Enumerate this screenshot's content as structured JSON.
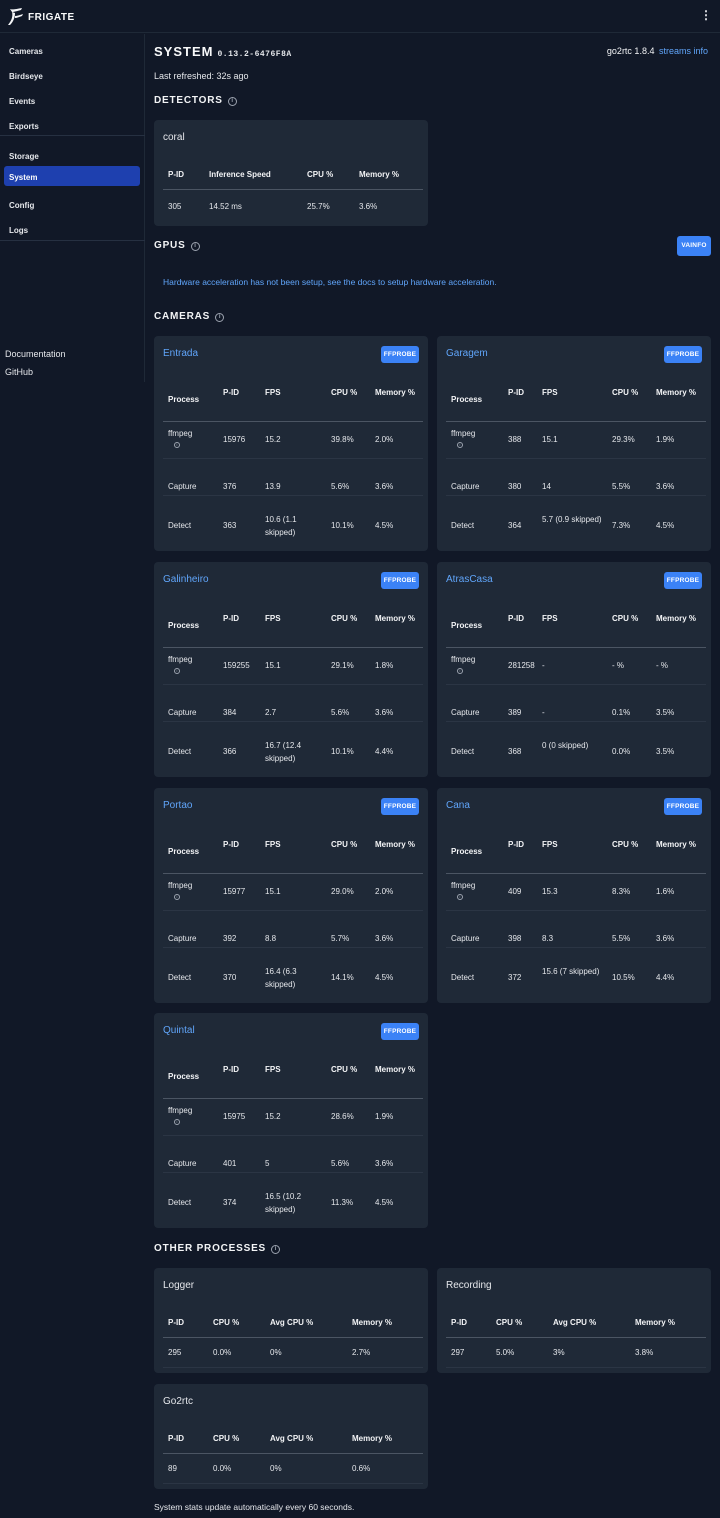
{
  "app": {
    "brand": "FRIGATE",
    "menu_icon": "kebab-menu-icon"
  },
  "sidebar": {
    "items": [
      {
        "label": "Cameras"
      },
      {
        "label": "Birdseye"
      },
      {
        "label": "Events"
      },
      {
        "label": "Exports"
      },
      {
        "label": "Storage"
      },
      {
        "label": "System",
        "active": true
      },
      {
        "label": "Config"
      },
      {
        "label": "Logs"
      }
    ],
    "links": [
      {
        "label": "Documentation"
      },
      {
        "label": "GitHub"
      }
    ]
  },
  "page": {
    "title": "SYSTEM",
    "version": "0.13.2-6476F8A",
    "go2rtc_version": "go2rtc 1.8.4",
    "streams_info": "streams info",
    "last_refreshed": "Last refreshed: 32s ago",
    "footer": "System stats update automatically every 60 seconds."
  },
  "detectors": {
    "section_title": "DETECTORS",
    "items": [
      {
        "name": "coral",
        "headers": [
          "P-ID",
          "Inference Speed",
          "CPU %",
          "Memory %"
        ],
        "row": [
          "305",
          "14.52 ms",
          "25.7%",
          "3.6%"
        ]
      }
    ]
  },
  "gpus": {
    "section_title": "GPUS",
    "vainfo_label": "VAINFO",
    "message": "Hardware acceleration has not been setup, see the docs to setup hardware acceleration."
  },
  "cameras": {
    "section_title": "CAMERAS",
    "ffprobe_label": "FFPROBE",
    "headers": {
      "process": "Process",
      "pid": "P-ID",
      "fps": "FPS",
      "cpu": "CPU %",
      "memory": "Memory %"
    },
    "items": [
      {
        "name": "Entrada",
        "rows": [
          {
            "process": "ffmpeg",
            "pid": "15976",
            "fps": "15.2",
            "cpu": "39.8%",
            "mem": "2.0%"
          },
          {
            "process": "Capture",
            "pid": "376",
            "fps": "13.9",
            "cpu": "5.6%",
            "mem": "3.6%"
          },
          {
            "process": "Detect",
            "pid": "363",
            "fps": "10.6 (1.1 skipped)",
            "cpu": "10.1%",
            "mem": "4.5%"
          }
        ]
      },
      {
        "name": "Garagem",
        "rows": [
          {
            "process": "ffmpeg",
            "pid": "388",
            "fps": "15.1",
            "cpu": "29.3%",
            "mem": "1.9%"
          },
          {
            "process": "Capture",
            "pid": "380",
            "fps": "14",
            "cpu": "5.5%",
            "mem": "3.6%"
          },
          {
            "process": "Detect",
            "pid": "364",
            "fps": "5.7 (0.9 skipped)",
            "cpu": "7.3%",
            "mem": "4.5%"
          }
        ]
      },
      {
        "name": "Galinheiro",
        "rows": [
          {
            "process": "ffmpeg",
            "pid": "159255",
            "fps": "15.1",
            "cpu": "29.1%",
            "mem": "1.8%"
          },
          {
            "process": "Capture",
            "pid": "384",
            "fps": "2.7",
            "cpu": "5.6%",
            "mem": "3.6%"
          },
          {
            "process": "Detect",
            "pid": "366",
            "fps": "16.7 (12.4 skipped)",
            "cpu": "10.1%",
            "mem": "4.4%"
          }
        ]
      },
      {
        "name": "AtrasCasa",
        "rows": [
          {
            "process": "ffmpeg",
            "pid": "281258",
            "fps": "-",
            "cpu": "- %",
            "mem": "- %"
          },
          {
            "process": "Capture",
            "pid": "389",
            "fps": "-",
            "cpu": "0.1%",
            "mem": "3.5%"
          },
          {
            "process": "Detect",
            "pid": "368",
            "fps": "0 (0 skipped)",
            "cpu": "0.0%",
            "mem": "3.5%"
          }
        ]
      },
      {
        "name": "Portao",
        "rows": [
          {
            "process": "ffmpeg",
            "pid": "15977",
            "fps": "15.1",
            "cpu": "29.0%",
            "mem": "2.0%"
          },
          {
            "process": "Capture",
            "pid": "392",
            "fps": "8.8",
            "cpu": "5.7%",
            "mem": "3.6%"
          },
          {
            "process": "Detect",
            "pid": "370",
            "fps": "16.4 (6.3 skipped)",
            "cpu": "14.1%",
            "mem": "4.5%"
          }
        ]
      },
      {
        "name": "Cana",
        "rows": [
          {
            "process": "ffmpeg",
            "pid": "409",
            "fps": "15.3",
            "cpu": "8.3%",
            "mem": "1.6%"
          },
          {
            "process": "Capture",
            "pid": "398",
            "fps": "8.3",
            "cpu": "5.5%",
            "mem": "3.6%"
          },
          {
            "process": "Detect",
            "pid": "372",
            "fps": "15.6 (7 skipped)",
            "cpu": "10.5%",
            "mem": "4.4%"
          }
        ]
      },
      {
        "name": "Quintal",
        "rows": [
          {
            "process": "ffmpeg",
            "pid": "15975",
            "fps": "15.2",
            "cpu": "28.6%",
            "mem": "1.9%"
          },
          {
            "process": "Capture",
            "pid": "401",
            "fps": "5",
            "cpu": "5.6%",
            "mem": "3.6%"
          },
          {
            "process": "Detect",
            "pid": "374",
            "fps": "16.5 (10.2 skipped)",
            "cpu": "11.3%",
            "mem": "4.5%"
          }
        ]
      }
    ]
  },
  "other_processes": {
    "section_title": "OTHER PROCESSES",
    "headers": [
      "P-ID",
      "CPU %",
      "Avg CPU %",
      "Memory %"
    ],
    "items": [
      {
        "name": "Logger",
        "row": [
          "295",
          "0.0%",
          "0%",
          "2.7%"
        ]
      },
      {
        "name": "Recording",
        "row": [
          "297",
          "5.0%",
          "3%",
          "3.8%"
        ]
      },
      {
        "name": "Go2rtc",
        "row": [
          "89",
          "0.0%",
          "0%",
          "0.6%"
        ]
      }
    ]
  }
}
